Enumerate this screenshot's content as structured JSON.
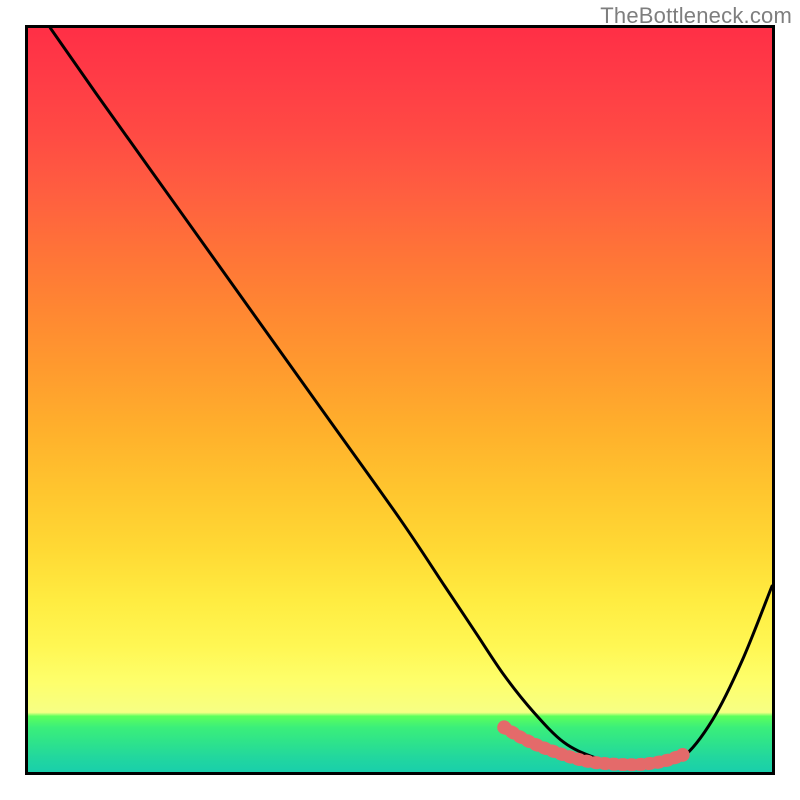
{
  "watermark": "TheBottleneck.com",
  "chart_data": {
    "type": "line",
    "title": "",
    "xlabel": "",
    "ylabel": "",
    "xlim": [
      0,
      100
    ],
    "ylim": [
      0,
      100
    ],
    "grid": false,
    "series": [
      {
        "name": "curve",
        "color": "#000000",
        "x": [
          3,
          10,
          20,
          30,
          40,
          50,
          56,
          60,
          64,
          68,
          72,
          76,
          80,
          84,
          88,
          92,
          96,
          100
        ],
        "y": [
          100,
          90,
          76,
          62,
          48,
          34,
          25,
          19,
          13,
          8,
          4,
          2,
          1,
          1,
          2,
          7,
          15,
          25
        ]
      },
      {
        "name": "optimal-band",
        "color": "#e46a6a",
        "x": [
          64,
          66,
          68,
          70,
          72,
          74,
          76,
          78,
          80,
          82,
          84,
          86,
          88
        ],
        "y": [
          6.0,
          4.8,
          3.8,
          3.0,
          2.3,
          1.7,
          1.3,
          1.1,
          1.0,
          1.0,
          1.2,
          1.6,
          2.3
        ]
      }
    ],
    "background_gradient": {
      "stops": [
        {
          "pos": 0,
          "color": "#ff2f46"
        },
        {
          "pos": 50,
          "color": "#ff9b2e"
        },
        {
          "pos": 85,
          "color": "#fff753"
        },
        {
          "pos": 93,
          "color": "#5cff5c"
        },
        {
          "pos": 100,
          "color": "#19cfab"
        }
      ]
    }
  }
}
